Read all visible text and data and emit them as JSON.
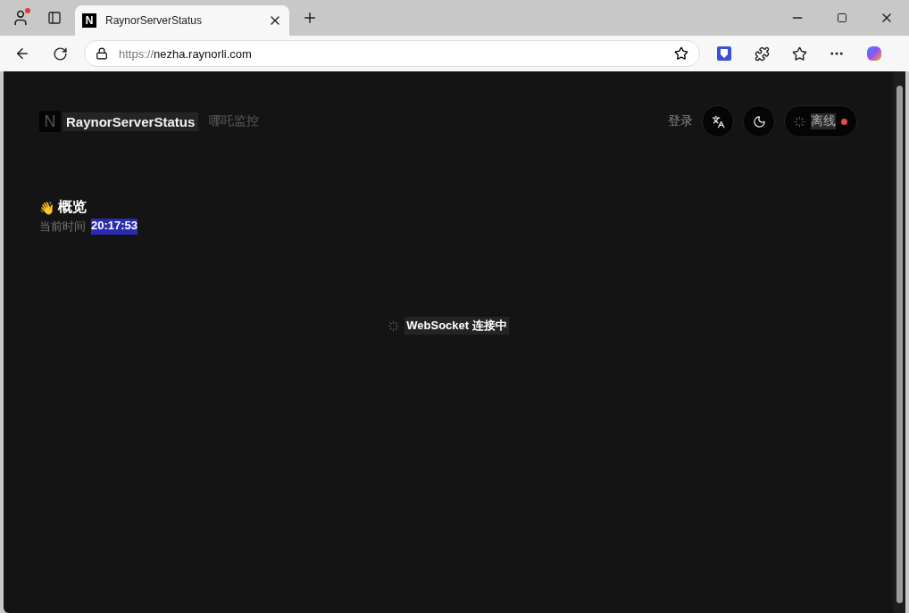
{
  "browser": {
    "tabs": [
      {
        "favicon_letter": "N",
        "title": "RaynorServerStatus",
        "selected": true
      }
    ],
    "url_scheme": "https://",
    "url_host": "nezha.raynorli.com"
  },
  "header": {
    "logo_letter": "N",
    "site_name": "RaynorServerStatus",
    "subtitle": "哪吒监控",
    "login": "登录",
    "status": {
      "label": "离线",
      "color": "#e5484d"
    }
  },
  "overview": {
    "emoji": "👋",
    "title": "概览",
    "time_label": "当前时间",
    "time": "20:17:53"
  },
  "loading": {
    "text": "WebSocket 连接中"
  }
}
